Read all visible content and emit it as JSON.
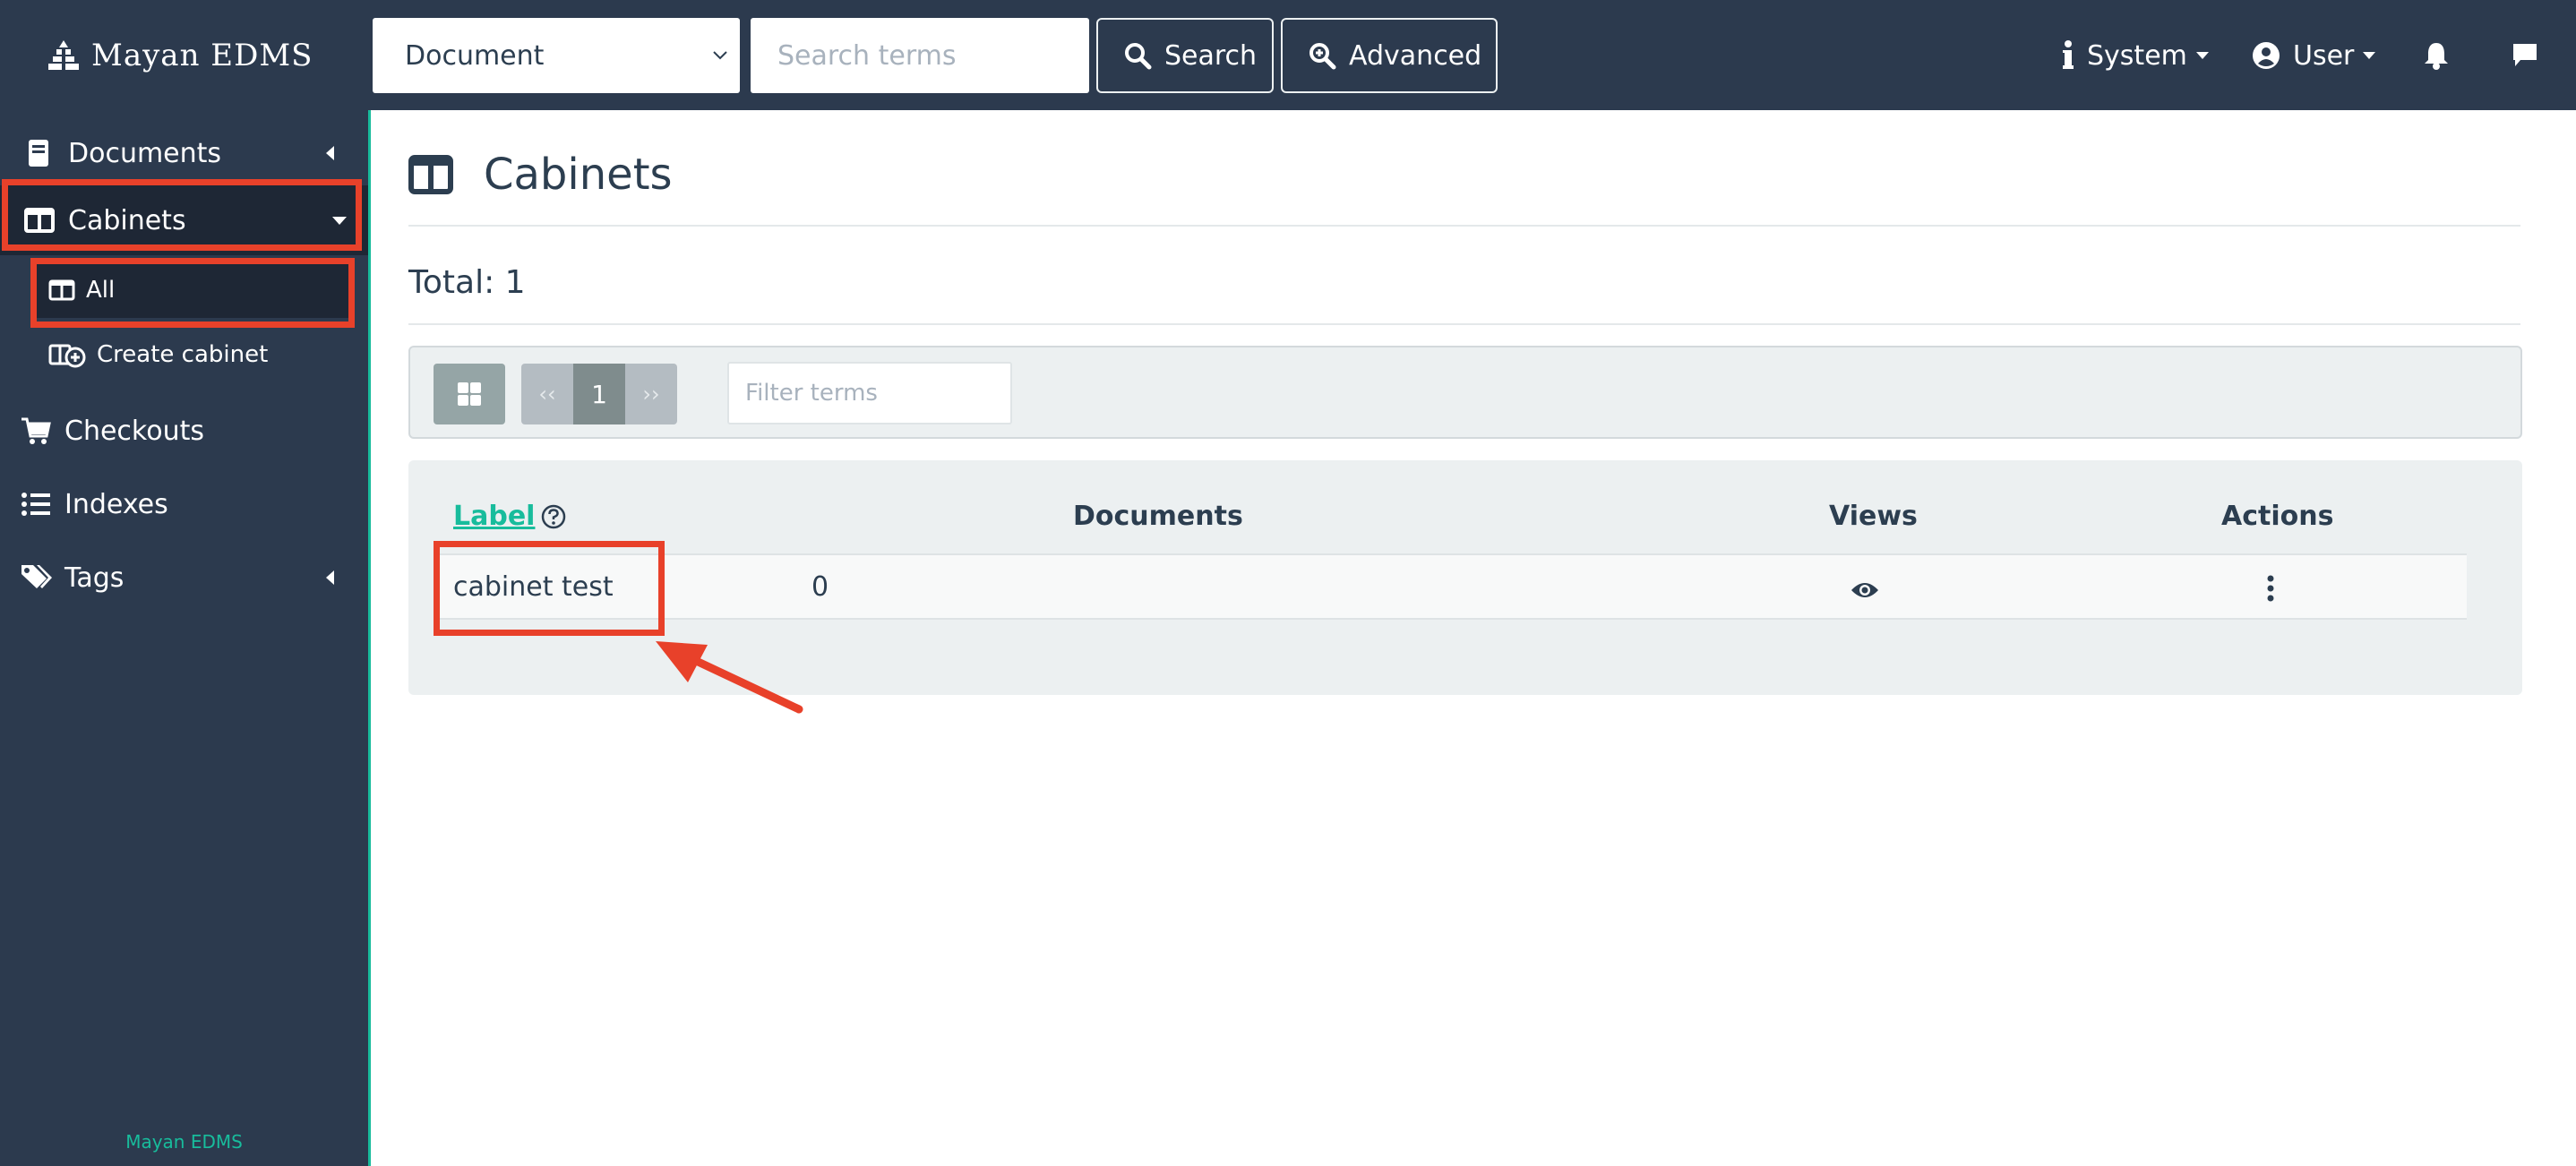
{
  "navbar": {
    "brand": "Mayan EDMS",
    "search_scope": "Document",
    "search_placeholder": "Search terms",
    "search_button": "Search",
    "advanced_button": "Advanced",
    "system_menu": "System",
    "user_menu": "User"
  },
  "sidebar": {
    "items": [
      {
        "label": "Documents"
      },
      {
        "label": "Cabinets"
      },
      {
        "label": "Checkouts"
      },
      {
        "label": "Indexes"
      },
      {
        "label": "Tags"
      }
    ],
    "cabinet_sub": [
      {
        "label": "All"
      },
      {
        "label": "Create cabinet"
      }
    ],
    "footer": "Mayan EDMS"
  },
  "main": {
    "title": "Cabinets",
    "total": "Total: 1",
    "pager": {
      "prev": "‹‹",
      "current": "1",
      "next": "››"
    },
    "filter_placeholder": "Filter terms",
    "table": {
      "columns": [
        "Label",
        "Documents",
        "Views",
        "Actions"
      ],
      "rows": [
        {
          "label": "cabinet test",
          "documents": "0"
        }
      ]
    }
  },
  "colors": {
    "navbar": "#2c3a4e",
    "accent": "#18bc9c",
    "annotation": "#e8412a"
  }
}
